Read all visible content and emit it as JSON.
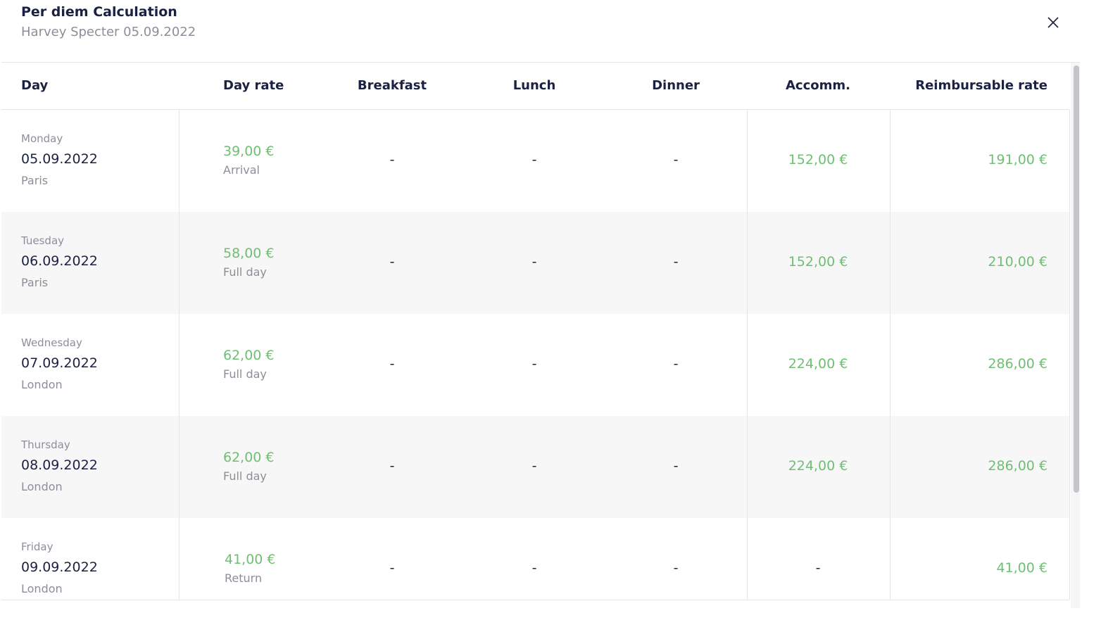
{
  "dialog": {
    "title": "Per diem Calculation",
    "subtitle": "Harvey Specter 05.09.2022",
    "close_icon": "close-icon"
  },
  "table": {
    "headers": {
      "day": "Day",
      "day_rate": "Day rate",
      "breakfast": "Breakfast",
      "lunch": "Lunch",
      "dinner": "Dinner",
      "accomm": "Accomm.",
      "reimbursable": "Reimbursable rate"
    },
    "rows": [
      {
        "weekday": "Monday",
        "date": "05.09.2022",
        "city": "Paris",
        "day_rate": "39,00 €",
        "rate_type": "Arrival",
        "breakfast": "-",
        "lunch": "-",
        "dinner": "-",
        "accomm": "152,00 €",
        "reimbursable": "191,00 €"
      },
      {
        "weekday": "Tuesday",
        "date": "06.09.2022",
        "city": "Paris",
        "day_rate": "58,00 €",
        "rate_type": "Full day",
        "breakfast": "-",
        "lunch": "-",
        "dinner": "-",
        "accomm": "152,00 €",
        "reimbursable": "210,00 €"
      },
      {
        "weekday": "Wednesday",
        "date": "07.09.2022",
        "city": "London",
        "day_rate": "62,00 €",
        "rate_type": "Full day",
        "breakfast": "-",
        "lunch": "-",
        "dinner": "-",
        "accomm": "224,00 €",
        "reimbursable": "286,00 €"
      },
      {
        "weekday": "Thursday",
        "date": "08.09.2022",
        "city": "London",
        "day_rate": "62,00 €",
        "rate_type": "Full day",
        "breakfast": "-",
        "lunch": "-",
        "dinner": "-",
        "accomm": "224,00 €",
        "reimbursable": "286,00 €"
      },
      {
        "weekday": "Friday",
        "date": "09.09.2022",
        "city": "London",
        "day_rate": "41,00 €",
        "rate_type": "Return",
        "breakfast": "-",
        "lunch": "-",
        "dinner": "-",
        "accomm": "-",
        "reimbursable": "41,00 €"
      }
    ]
  },
  "colors": {
    "amount_green": "#6fbf73",
    "text_dark": "#1b2141",
    "text_muted": "#8c8f99",
    "row_alt": "#f7f7f7"
  }
}
